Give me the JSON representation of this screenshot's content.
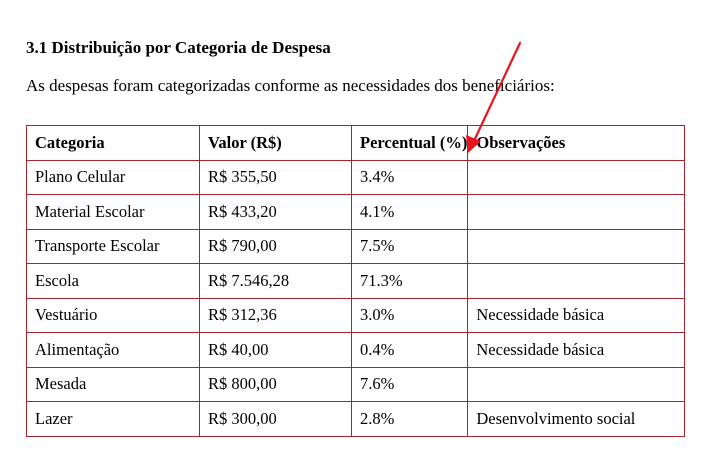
{
  "section": {
    "heading": "3.1 Distribuição por Categoria de Despesa",
    "intro": "As despesas foram categorizadas conforme as necessidades dos beneficiários:"
  },
  "table": {
    "headers": [
      "Categoria",
      "Valor (R$)",
      "Percentual (%)",
      "Observações"
    ],
    "rows": [
      [
        "Plano Celular",
        "R$ 355,50",
        "3.4%",
        ""
      ],
      [
        "Material Escolar",
        "R$ 433,20",
        "4.1%",
        ""
      ],
      [
        "Transporte Escolar",
        "R$ 790,00",
        "7.5%",
        ""
      ],
      [
        "Escola",
        "R$ 7.546,28",
        "71.3%",
        ""
      ],
      [
        "Vestuário",
        "R$ 312,36",
        "3.0%",
        "Necessidade básica"
      ],
      [
        "Alimentação",
        "R$ 40,00",
        "0.4%",
        "Necessidade básica"
      ],
      [
        "Mesada",
        "R$ 800,00",
        "7.6%",
        ""
      ],
      [
        "Lazer",
        "R$ 300,00",
        "2.8%",
        "Desenvolvimento social"
      ]
    ]
  },
  "colors": {
    "table_border": "#a8232e",
    "annotation_arrow": "#e8141c"
  }
}
